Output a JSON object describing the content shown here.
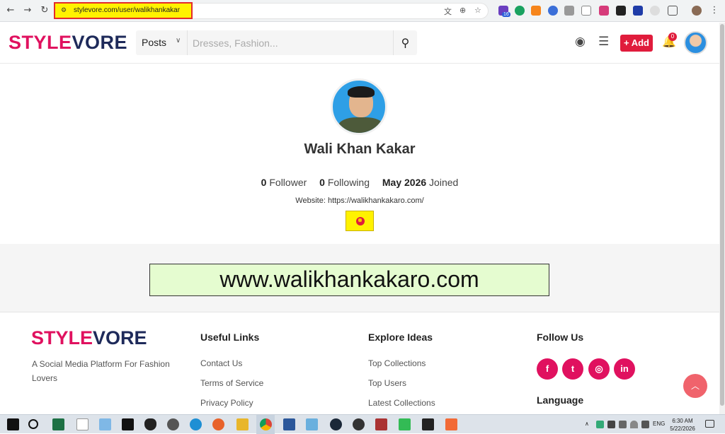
{
  "browser": {
    "url": "stylevore.com/user/walikhankakar",
    "ext_badge": "16"
  },
  "header": {
    "logo_part1": "STYLE",
    "logo_part2": "VORE",
    "search_type": "Posts",
    "search_placeholder": "Dresses, Fashion...",
    "add_label": "+ Add",
    "notification_count": "0"
  },
  "profile": {
    "name": "Wali Khan Kakar",
    "followers_count": "0",
    "followers_label": "Follower",
    "following_count": "0",
    "following_label": "Following",
    "joined_date": "May 2026",
    "joined_label": "Joined",
    "website": "Website: https://walikhankakaro.com/"
  },
  "banner": {
    "text": "www.walikhankakaro.com"
  },
  "footer": {
    "logo_part1": "STYLE",
    "logo_part2": "VORE",
    "tagline": "A Social Media Platform For Fashion Lovers",
    "useful_links": {
      "title": "Useful Links",
      "items": [
        "Contact Us",
        "Terms of Service",
        "Privacy Policy"
      ]
    },
    "explore": {
      "title": "Explore Ideas",
      "items": [
        "Top Collections",
        "Top Users",
        "Latest Collections"
      ]
    },
    "follow": {
      "title": "Follow Us",
      "icons": [
        "facebook-icon",
        "twitter-icon",
        "instagram-icon",
        "linkedin-icon"
      ]
    },
    "language_title": "Language"
  },
  "taskbar": {
    "lang": "ENG",
    "time": "6:30 AM",
    "date": "5/22/2026"
  },
  "colors": {
    "brand_pink": "#e0115f",
    "brand_navy": "#1e2a5a",
    "add_red": "#e01c3c",
    "highlight_yellow": "#fff200",
    "banner_green": "#e5fcd0"
  }
}
